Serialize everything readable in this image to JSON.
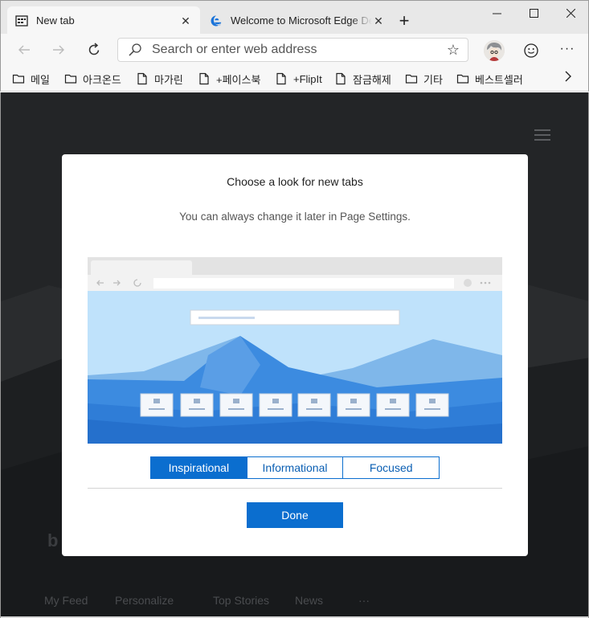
{
  "tabs": [
    {
      "label": "New tab",
      "icon": "new-tab-page-icon",
      "active": true
    },
    {
      "label": "Welcome to Microsoft Edge Dev",
      "icon": "edge-logo-icon",
      "active": false
    }
  ],
  "window": {
    "minimize": "minimize-icon",
    "maximize": "maximize-icon",
    "close": "close-icon"
  },
  "toolbar": {
    "address_placeholder": "Search or enter web address"
  },
  "favorites": [
    {
      "label": "메일",
      "icon": "folder-icon"
    },
    {
      "label": "아크온드",
      "icon": "folder-icon"
    },
    {
      "label": "마가린",
      "icon": "page-icon"
    },
    {
      "label": "+페이스북",
      "icon": "page-icon"
    },
    {
      "label": "+FlipIt",
      "icon": "page-icon"
    },
    {
      "label": "잠금해제",
      "icon": "page-icon"
    },
    {
      "label": "기타",
      "icon": "folder-icon"
    },
    {
      "label": "베스트셀러",
      "icon": "folder-icon"
    }
  ],
  "background_feed": {
    "items": [
      "My Feed",
      "Personalize",
      "Top Stories",
      "News",
      "···"
    ]
  },
  "dialog": {
    "title": "Choose a look for new tabs",
    "subtitle": "You can always change it later in Page Settings.",
    "options": [
      "Inspirational",
      "Informational",
      "Focused"
    ],
    "selected": "Inspirational",
    "done_label": "Done"
  },
  "colors": {
    "accent": "#0b6ecf",
    "page_background": "#222426"
  }
}
